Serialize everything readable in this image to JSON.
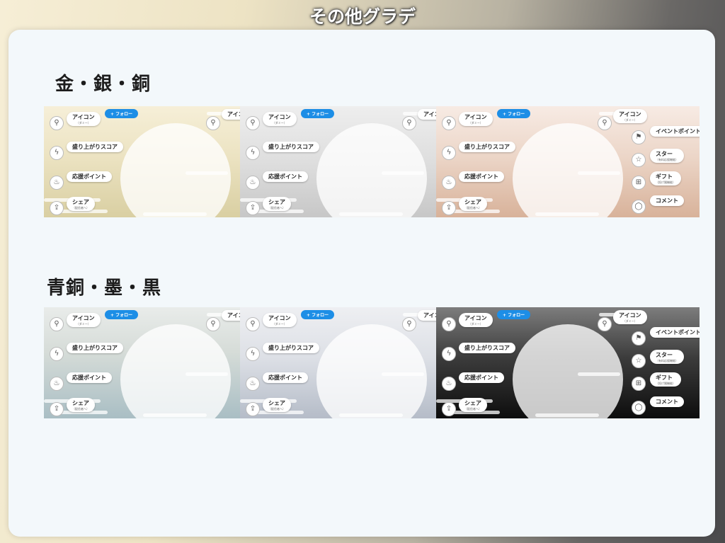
{
  "title": "その他グラデ",
  "sections": [
    {
      "heading": "金・銀・銅",
      "frames": [
        {
          "bg": "linear-gradient(180deg,#f6efd8 0%,#ece3c2 45%,#d9cfa2 100%)"
        },
        {
          "bg": "linear-gradient(180deg,#eeeeee 0%,#dedede 50%,#c7c7c7 100%)"
        },
        {
          "bg": "linear-gradient(180deg,#f7ebe4 0%,#ecd6c8 45%,#d8b29a 100%)"
        }
      ]
    },
    {
      "heading": "青銅・墨・黒",
      "frames": [
        {
          "bg": "linear-gradient(180deg,#e9ecea 0%,#d6dcd8 40%,#a9bec4 100%)"
        },
        {
          "bg": "linear-gradient(180deg,#eeeff2 0%,#dde0e6 45%,#b5bcc8 100%)"
        },
        {
          "bg": "linear-gradient(180deg,#7d7d7d 0%,#3c3c3c 45%,#0d0d0d 100%)"
        }
      ]
    }
  ],
  "widget": {
    "icon_label": "アイコン",
    "icon_sub": "（ダミー）",
    "follow_label": "+ フォロー",
    "score_label": "盛り上がりスコア",
    "support_label": "応援ポイント",
    "share_label": "シェア",
    "share_sub": "（配信者へ）",
    "event_label": "イベントポイント",
    "star_label": "スター",
    "star_sub": "（有料応援機能）",
    "gift_label": "ギフト",
    "gift_sub": "（投げ銭機能）",
    "comment_label": "コメント",
    "icon_names": [
      "person-icon",
      "lightning-icon",
      "fire-icon",
      "share-icon",
      "flag-icon",
      "star-icon",
      "gift-icon",
      "comment-icon"
    ]
  }
}
